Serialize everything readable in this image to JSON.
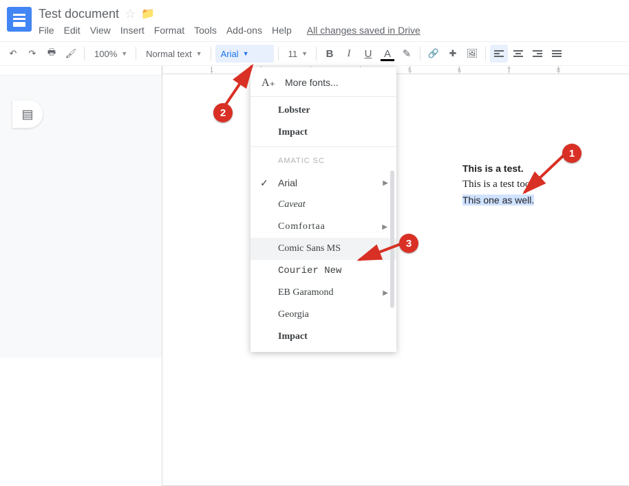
{
  "header": {
    "title": "Test document",
    "drive_status": "All changes saved in Drive"
  },
  "menu": {
    "file": "File",
    "edit": "Edit",
    "view": "View",
    "insert": "Insert",
    "format": "Format",
    "tools": "Tools",
    "addons": "Add-ons",
    "help": "Help"
  },
  "toolbar": {
    "zoom": "100%",
    "styles": "Normal text",
    "font": "Arial",
    "size": "11"
  },
  "font_menu": {
    "more_fonts": "More fonts...",
    "recent": [
      "Lobster",
      "Impact"
    ],
    "section_label": "Amatic SC",
    "fonts": [
      {
        "name": "Arial",
        "checked": true,
        "submenu": true
      },
      {
        "name": "Caveat",
        "submenu": false
      },
      {
        "name": "Comfortaa",
        "submenu": true
      },
      {
        "name": "Comic Sans MS",
        "submenu": false,
        "hover": true
      },
      {
        "name": "Courier New",
        "submenu": false
      },
      {
        "name": "EB Garamond",
        "submenu": true
      },
      {
        "name": "Georgia",
        "submenu": false
      },
      {
        "name": "Impact",
        "submenu": false
      }
    ]
  },
  "document": {
    "line1": "This is a test.",
    "line2": "This is a test too.",
    "line3": "This one as well."
  },
  "annotations": {
    "b1": "1",
    "b2": "2",
    "b3": "3"
  }
}
